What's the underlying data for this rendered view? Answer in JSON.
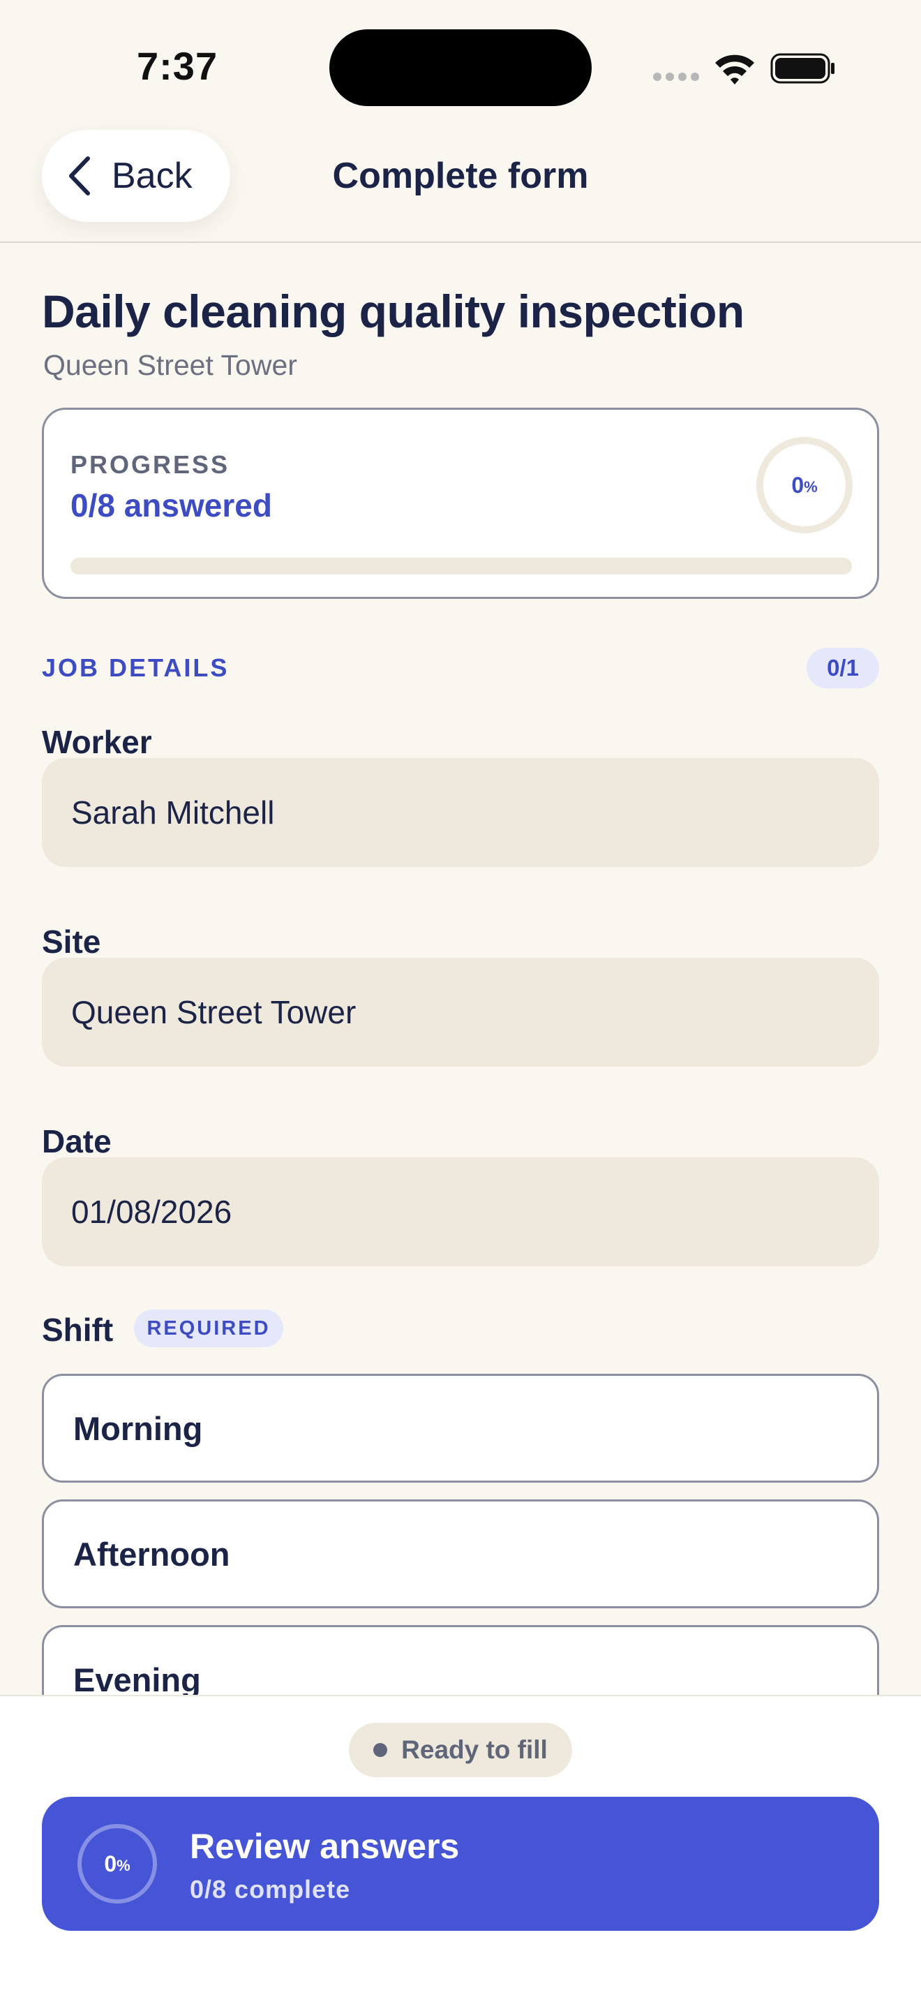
{
  "status_bar": {
    "time": "7:37"
  },
  "nav": {
    "back_label": "Back",
    "title": "Complete form"
  },
  "form": {
    "title": "Daily cleaning quality inspection",
    "subtitle": "Queen Street Tower"
  },
  "progress": {
    "label": "PROGRESS",
    "answered_text": "0/8 answered",
    "percent_number": "0",
    "percent_sign": "%",
    "fraction": 0
  },
  "section": {
    "title": "JOB DETAILS",
    "count": "0/1"
  },
  "fields": {
    "worker": {
      "label": "Worker",
      "value": "Sarah Mitchell"
    },
    "site": {
      "label": "Site",
      "value": "Queen Street Tower"
    },
    "date": {
      "label": "Date",
      "value": "01/08/2026"
    },
    "shift": {
      "label": "Shift",
      "badge": "REQUIRED",
      "options": [
        "Morning",
        "Afternoon",
        "Evening"
      ]
    }
  },
  "footer": {
    "status": "Ready to fill",
    "button_title": "Review answers",
    "button_sub": "0/8 complete",
    "percent_number": "0",
    "percent_sign": "%"
  },
  "colors": {
    "accent": "#4655d6",
    "accent_text": "#3d4cc2",
    "background": "#faf7f1",
    "field_fill": "#efe8dc"
  }
}
